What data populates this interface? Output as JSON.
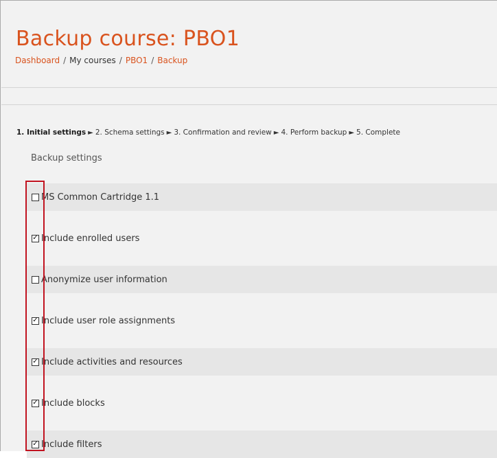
{
  "page": {
    "title": "Backup course: PBO1"
  },
  "breadcrumb": {
    "items": [
      "Dashboard",
      "My courses",
      "PBO1",
      "Backup"
    ],
    "separator": "/"
  },
  "steps": {
    "items": [
      "1. Initial settings",
      "2. Schema settings",
      "3. Confirmation and review",
      "4. Perform backup",
      "5. Complete"
    ],
    "arrow": "►",
    "active_index": 0
  },
  "backup_settings": {
    "title": "Backup settings",
    "items": [
      {
        "label": "MS Common Cartridge 1.1",
        "checked": false
      },
      {
        "label": "Include enrolled users",
        "checked": true
      },
      {
        "label": "Anonymize user information",
        "checked": false
      },
      {
        "label": "Include user role assignments",
        "checked": true
      },
      {
        "label": "Include activities and resources",
        "checked": true
      },
      {
        "label": "Include blocks",
        "checked": true
      },
      {
        "label": "Include filters",
        "checked": true
      }
    ]
  },
  "colors": {
    "accent": "#d9531e",
    "highlight_box": "#c1121f"
  }
}
